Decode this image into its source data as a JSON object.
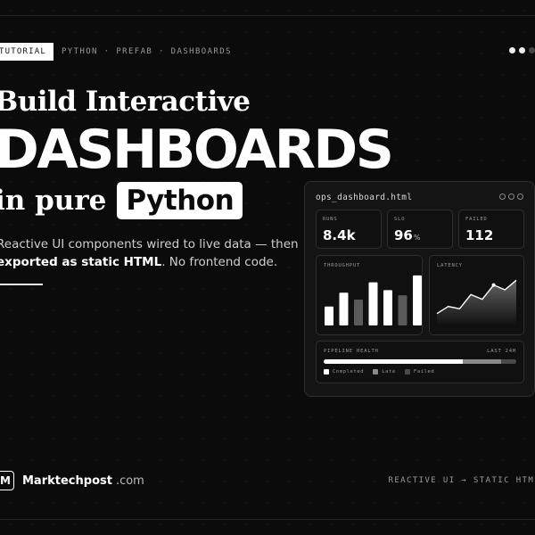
{
  "header": {
    "tag": "TUTORIAL",
    "breadcrumbs": "PYTHON · PREFAB · DASHBOARDS",
    "pager": [
      true,
      true,
      false
    ]
  },
  "hero": {
    "line1": "Build Interactive",
    "line2": "DASHBOARDS",
    "line3_prefix": "in pure",
    "line3_pill": "Python",
    "desc_line1": "Reactive UI components wired to live data — then",
    "desc_strong": "exported as static HTML",
    "desc_rest": ". No frontend code."
  },
  "dashboard": {
    "title": "ops_dashboard.html",
    "stats": [
      {
        "label": "RUNS",
        "value": "8.4k",
        "unit": ""
      },
      {
        "label": "SLO",
        "value": "96",
        "unit": "%"
      },
      {
        "label": "FAILED",
        "value": "112",
        "unit": ""
      }
    ],
    "throughput_label": "THROUGHPUT",
    "latency_label": "LATENCY",
    "pipeline_label": "PIPELINE HEALTH",
    "pipeline_range": "LAST 24H",
    "legend": [
      "Completed",
      "Late",
      "Failed"
    ],
    "colors": {
      "completed": "#ffffff",
      "late": "#8a8a8a",
      "failed": "#4a4a4a"
    }
  },
  "chart_data": [
    {
      "type": "bar",
      "title": "THROUGHPUT",
      "values": [
        22,
        38,
        30,
        50,
        41,
        35,
        58
      ],
      "colors": [
        "#ffffff",
        "#ffffff",
        "#5a5a5a",
        "#ffffff",
        "#ffffff",
        "#5a5a5a",
        "#ffffff"
      ],
      "ylim": [
        0,
        60
      ]
    },
    {
      "type": "area",
      "title": "LATENCY",
      "values": [
        10,
        16,
        14,
        26,
        22,
        34,
        30,
        38
      ],
      "ylim": [
        0,
        45
      ]
    },
    {
      "type": "bar",
      "title": "PIPELINE HEALTH",
      "categories": [
        "Completed",
        "Late",
        "Failed"
      ],
      "values": [
        0.72,
        0.2,
        0.08
      ]
    }
  ],
  "footer": {
    "logo_letter": "M",
    "brand": "Marktechpost",
    "tld": ".com",
    "tagline": "REACTIVE UI → STATIC HTML"
  }
}
